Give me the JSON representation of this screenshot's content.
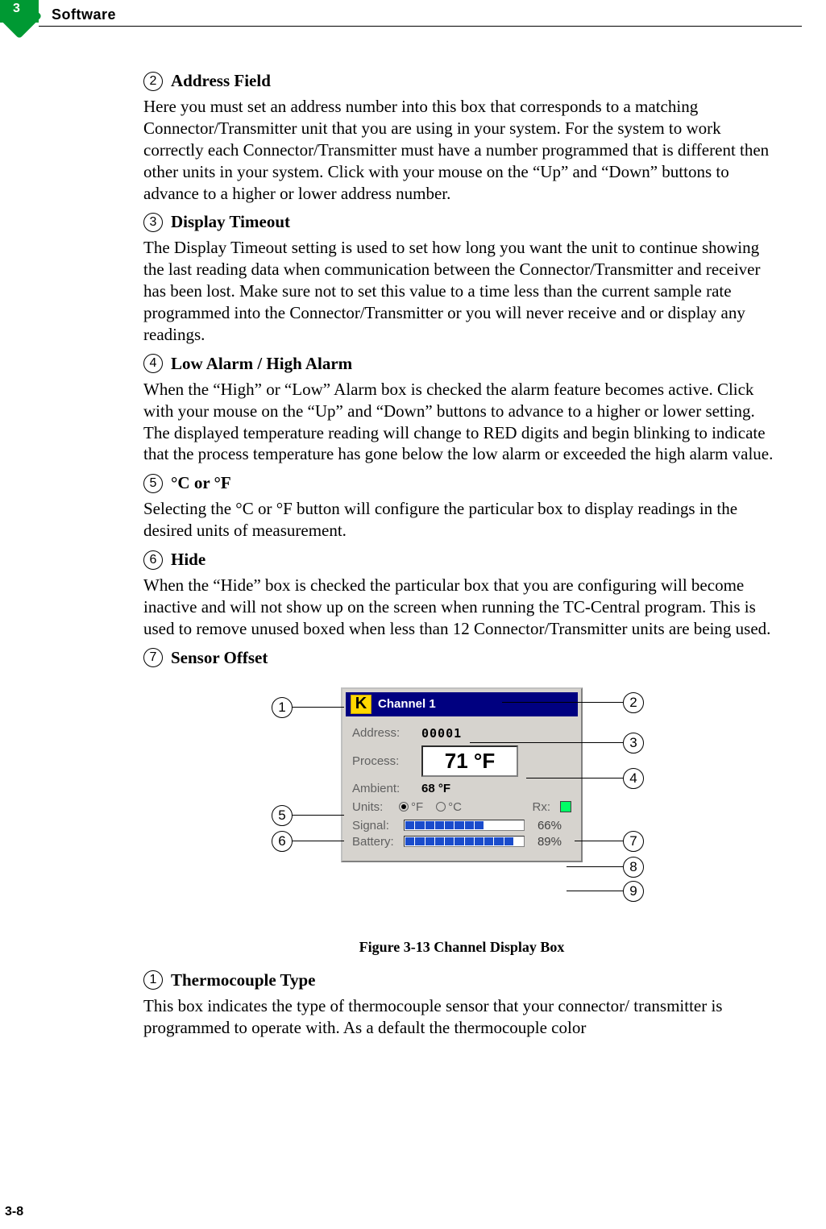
{
  "header": {
    "chapter_number": "3",
    "section_title": "Software"
  },
  "sections": [
    {
      "num": "2",
      "title": "Address Field",
      "body": "Here you must set an address number into this box that corresponds to a matching Connector/Transmitter unit that you are using in your system. For the system to work correctly each Connector/Transmitter must have a number programmed that is different then other units in your system. Click with your mouse on the “Up” and “Down” buttons to advance to a higher or lower address number."
    },
    {
      "num": "3",
      "title": "Display Timeout",
      "body": "The Display Timeout setting is used to set how long you want the unit to continue showing the last reading data when communication between the Connector/Transmitter and receiver has been lost. Make sure not to set this value to a time less than the current sample rate programmed into the Connector/Transmitter or you will never receive and or display any readings."
    },
    {
      "num": "4",
      "title": "Low Alarm / High Alarm",
      "body": "When the “High” or “Low” Alarm box is checked the alarm feature becomes active. Click with your mouse on the “Up” and “Down” buttons to advance to a higher or lower setting. The displayed temperature reading will change to RED digits and begin blinking to indicate that the process temperature has gone below the low alarm or exceeded the high alarm value."
    },
    {
      "num": "5",
      "title": "°C or °F",
      "body": "Selecting the °C or °F button will configure the particular box to display readings in the desired units of measurement."
    },
    {
      "num": "6",
      "title": "Hide",
      "body": "When the “Hide” box is checked the particular box that you are configuring will become inactive and will not show up on the screen when running the TC-Central program. This is used to remove unused boxed when less than 12 Connector/Transmitter units are being used."
    },
    {
      "num": "7",
      "title": "Sensor Offset",
      "body": ""
    }
  ],
  "figure": {
    "panel": {
      "tc_type": "K",
      "channel_title": "Channel 1",
      "labels": {
        "address": "Address:",
        "process": "Process:",
        "ambient": "Ambient:",
        "units": "Units:",
        "rx": "Rx:",
        "signal": "Signal:",
        "battery": "Battery:"
      },
      "address_value": "00001",
      "process_value": "71 °F",
      "ambient_value": "68 °F",
      "unit_f": "°F",
      "unit_c": "°C",
      "signal_pct": "66%",
      "battery_pct": "89%"
    },
    "callouts": {
      "c1": "1",
      "c2": "2",
      "c3": "3",
      "c4": "4",
      "c5": "5",
      "c6": "6",
      "c7": "7",
      "c8": "8",
      "c9": "9"
    },
    "caption": "Figure 3-13  Channel Display Box"
  },
  "after_figure": {
    "num": "1",
    "title": "Thermocouple Type",
    "body": "This box indicates the type of thermocouple sensor that your connector/ transmitter is programmed to operate with. As a default the thermocouple color"
  },
  "page_number": "3-8"
}
